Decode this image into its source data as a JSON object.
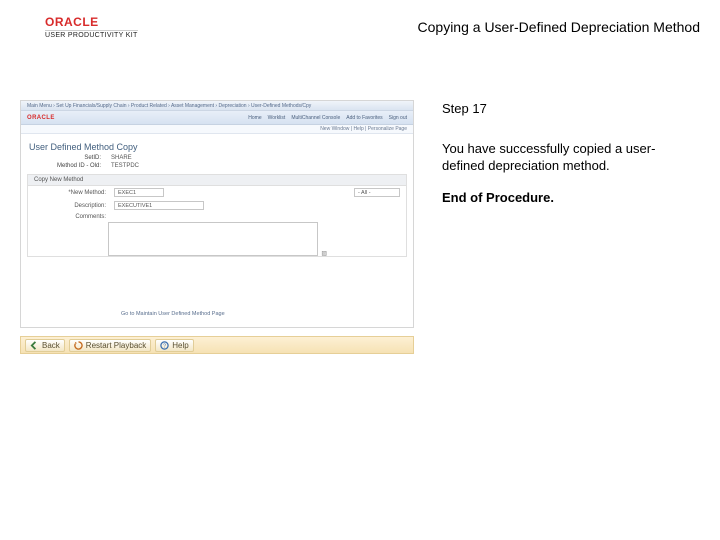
{
  "header": {
    "logo_main": "ORACLE",
    "logo_sub": "USER PRODUCTIVITY KIT",
    "title": "Copying a User-Defined Depreciation Method"
  },
  "right": {
    "step": "Step 17",
    "body": "You have successfully copied a user-defined depreciation method.",
    "end": "End of Procedure."
  },
  "thumb": {
    "browser_line": "Main Menu  ›  Set Up Financials/Supply Chain  ›  Product Related  ›  Asset Management  ›  Depreciation  ›  User-Defined Methods/Cpy",
    "tabs": [
      "Home",
      "Worklist",
      "MultiChannel Console",
      "Add to Favorites",
      "Sign out"
    ],
    "sub": "New Window | Help | Personalize Page",
    "page_title": "User Defined Method Copy",
    "setid_label": "SetID:",
    "setid_value": "SHARE",
    "method_label": "Method ID - Old:",
    "method_value": "TESTPDC",
    "section_head": "Copy New Method",
    "newmethod_label": "*New Method:",
    "newmethod_value": "EXEC1",
    "newmethod_select": "- All -",
    "desc_label": "Description:",
    "desc_value": "EXECUTIVE1",
    "comments_label": "Comments:",
    "footer_link": "Go to Maintain User Defined Method Page",
    "oracle": "ORACLE"
  },
  "toolbar": {
    "back": "Back",
    "reset": "Restart Playback",
    "help": "Help"
  },
  "icons": {
    "back": "back-icon",
    "reset": "reset-icon",
    "help": "help-icon"
  }
}
